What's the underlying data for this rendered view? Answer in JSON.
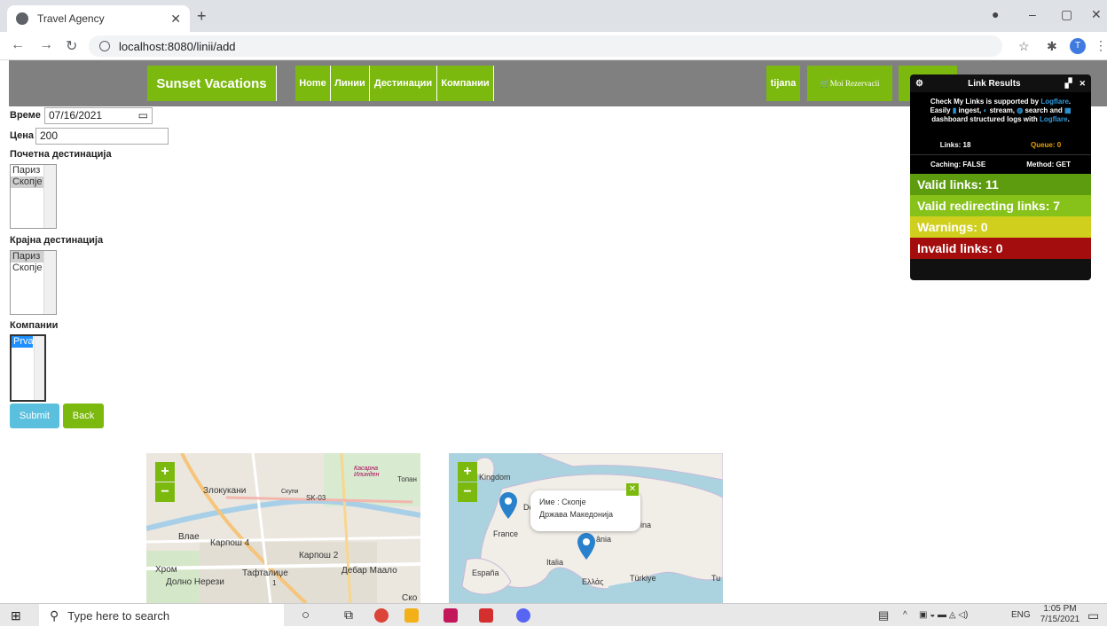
{
  "browser": {
    "tab_title": "Travel Agency",
    "url": "localhost:8080/linii/add",
    "profile_initial": "T"
  },
  "navbar": {
    "brand": "Sunset Vacations",
    "links": [
      "Home",
      "Линии",
      "Дестинации",
      "Компании"
    ],
    "user": "tijana",
    "reservations": "Moi Rezervacii"
  },
  "form": {
    "time_label": "Време",
    "time_value": "07/16/2021",
    "price_label": "Цена",
    "price_value": "200",
    "start_label": "Почетна дестинација",
    "start_options": [
      "Париз",
      "Скопје"
    ],
    "end_label": "Крајна дестинација",
    "end_options": [
      "Париз",
      "Скопје"
    ],
    "companies_label": "Компании",
    "company_options": [
      "Prva"
    ],
    "submit": "Submit",
    "back": "Back"
  },
  "map1": {
    "labels": [
      "Злокукани",
      "Скупи",
      "SK-03",
      "Касарна Илинден",
      "Топан",
      "Влае",
      "Карпош 4",
      "Карпош 2",
      "Хром",
      "Тафталиџе",
      "1",
      "Дебар Маало",
      "Долно Нерези",
      "Ско"
    ]
  },
  "map2": {
    "labels": [
      "Kingdom",
      "Deu",
      "France",
      "Italia",
      "España",
      "Ελλάς",
      "Türkiye",
      "Tu",
      "ânia",
      "ina"
    ],
    "popup_name": "Име : Скопје",
    "popup_country": "Држава Македонија"
  },
  "link_panel": {
    "title": "Link Results",
    "info_line1": "Check My Links is supported by",
    "info_brand": "Logflare",
    "info_line2": "Easily",
    "info_line3": "ingest,",
    "info_line4": "stream,",
    "info_line5": "search and",
    "info_line6": "dashboard structured logs with",
    "links": "Links: 18",
    "queue": "Queue: 0",
    "caching": "Caching: FALSE",
    "method": "Method: GET",
    "valid": "Valid links: 11",
    "redirecting": "Valid redirecting links: 7",
    "warnings": "Warnings: 0",
    "invalid": "Invalid links: 0"
  },
  "taskbar": {
    "search_placeholder": "Type here to search",
    "lang": "ENG",
    "time": "1:05 PM",
    "date": "7/15/2021"
  }
}
